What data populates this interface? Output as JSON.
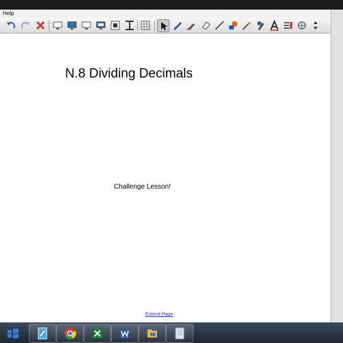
{
  "menu": {
    "help_label": "Help"
  },
  "toolbar": {
    "buttons": [
      "undo-icon",
      "redo-icon",
      "delete-icon",
      "screen-shade-icon",
      "monitor-icon",
      "display-icon",
      "projector-icon",
      "capture-icon",
      "screen-capture-icon",
      "table-icon",
      "select-pointer-icon",
      "pen-icon",
      "creative-pen-icon",
      "eraser-icon",
      "line-icon",
      "fill-icon",
      "magic-pen-icon",
      "shape-recognition-icon",
      "text-icon",
      "properties-icon",
      "highlighter-icon",
      "more-icon"
    ]
  },
  "page": {
    "title": "N.8 Dividing Decimals",
    "subtitle": "Challenge Lesson!",
    "extend_label": "Extend Page"
  },
  "taskbar": {
    "items": [
      "start-icon",
      "notebook-icon",
      "chrome-icon",
      "excel-icon",
      "word-icon",
      "explorer-icon",
      "document-icon"
    ]
  },
  "colors": {
    "link": "#2233cc",
    "page_bg": "#ffffff",
    "taskbar": "#1d2733"
  }
}
